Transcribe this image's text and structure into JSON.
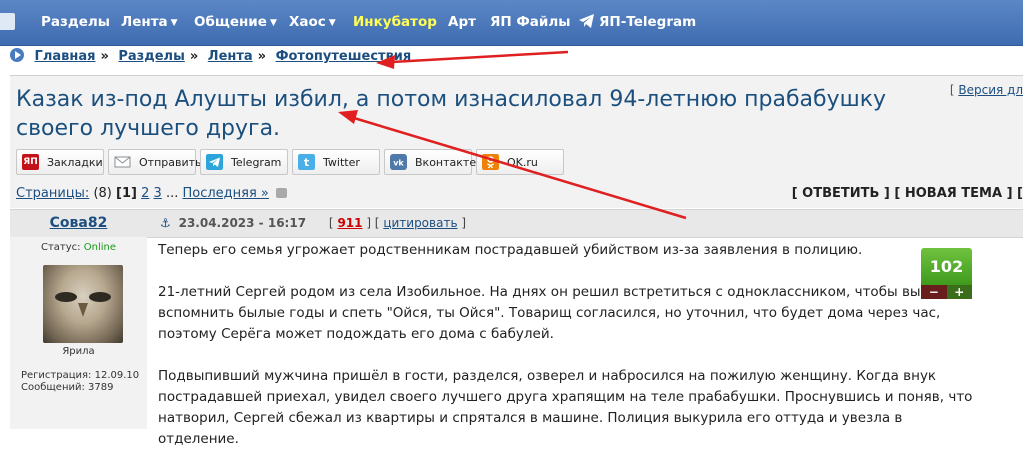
{
  "nav": {
    "items": [
      {
        "label": "Разделы",
        "dropdown": false
      },
      {
        "label": "Лента",
        "dropdown": true
      },
      {
        "label": "Общение",
        "dropdown": true
      },
      {
        "label": "Хаос",
        "dropdown": true
      },
      {
        "label": "Инкубатор",
        "dropdown": false,
        "color": "#ffff55"
      },
      {
        "label": "Арт",
        "dropdown": false
      },
      {
        "label": "ЯП Файлы",
        "dropdown": false
      },
      {
        "label": "ЯП-Telegram",
        "dropdown": false,
        "icon": "telegram-icon"
      }
    ]
  },
  "breadcrumb": {
    "items": [
      "Главная",
      "Разделы",
      "Лента",
      "Фотопутешествия"
    ],
    "separator": "»"
  },
  "topic": {
    "title": "Казак из-под Алушты избил, а потом изнасиловал 94-летнюю прабабушку своего лучшего друга.",
    "version_prefix": "[",
    "version_link": "Версия дл"
  },
  "share": {
    "buttons": [
      {
        "label": "Закладки",
        "icon": "yap-bookmark-icon",
        "color": "#c4121b"
      },
      {
        "label": "Отправить",
        "icon": "envelope-icon",
        "color": "#9aa0a6"
      },
      {
        "label": "Telegram",
        "icon": "telegram-icon",
        "color": "#2ea5da"
      },
      {
        "label": "Twitter",
        "icon": "twitter-icon",
        "color": "#4aaee8"
      },
      {
        "label": "Вконтакте",
        "icon": "vk-icon",
        "color": "#4f79a8"
      },
      {
        "label": "OK.ru",
        "icon": "odnoklassniki-icon",
        "color": "#ee8208"
      }
    ]
  },
  "pagination": {
    "label": "Страницы:",
    "count": "(8)",
    "current": "[1]",
    "pages": [
      "2",
      "3"
    ],
    "ellipsis": "...",
    "last": "Последняя »",
    "reply": "[ ОТВЕТИТЬ ]",
    "new_topic": "[ НОВАЯ ТЕМА ]",
    "more": "["
  },
  "post": {
    "author": "Сова82",
    "date": "23.04.2023 - 16:17",
    "number": "911",
    "quote": "цитировать",
    "status_label": "Статус:",
    "status_value": "Online",
    "avatar_caption": "Ярила",
    "reg_label": "Регистрация: 12.09.10",
    "posts_label": "Сообщений: 3789",
    "rating": "102",
    "minus": "−",
    "plus": "+",
    "paragraphs": [
      "Теперь его семья угрожает родственникам пострадавшей убийством из-за заявления в полицию.",
      "21-летний Сергей родом из села Изобильное. На днях он решил встретиться с одноклассником, чтобы выпить, вспомнить былые годы и спеть \"Ойся, ты Ойся\". Товарищ согласился, но уточнил, что будет дома через час, поэтому Серёга может подождать его дома с бабулей.",
      "Подвыпивший мужчина пришёл в гости, разделся, озверел и набросился на пожилую женщину. Когда внук пострадавшей приехал, увидел своего лучшего друга храпящим на теле прабабушки. Проснувшись и поняв, что натворил, Сергей сбежал из квартиры и спрятался в машине. Полиция выкурила его оттуда и увезла в отделение."
    ]
  },
  "colors": {
    "nav_bg": "#4a78bb",
    "link": "#1c4e80",
    "title": "#1b4f7e",
    "online": "#1a9a1a",
    "rating": "#4fa82a",
    "arrow": "#e02020"
  }
}
